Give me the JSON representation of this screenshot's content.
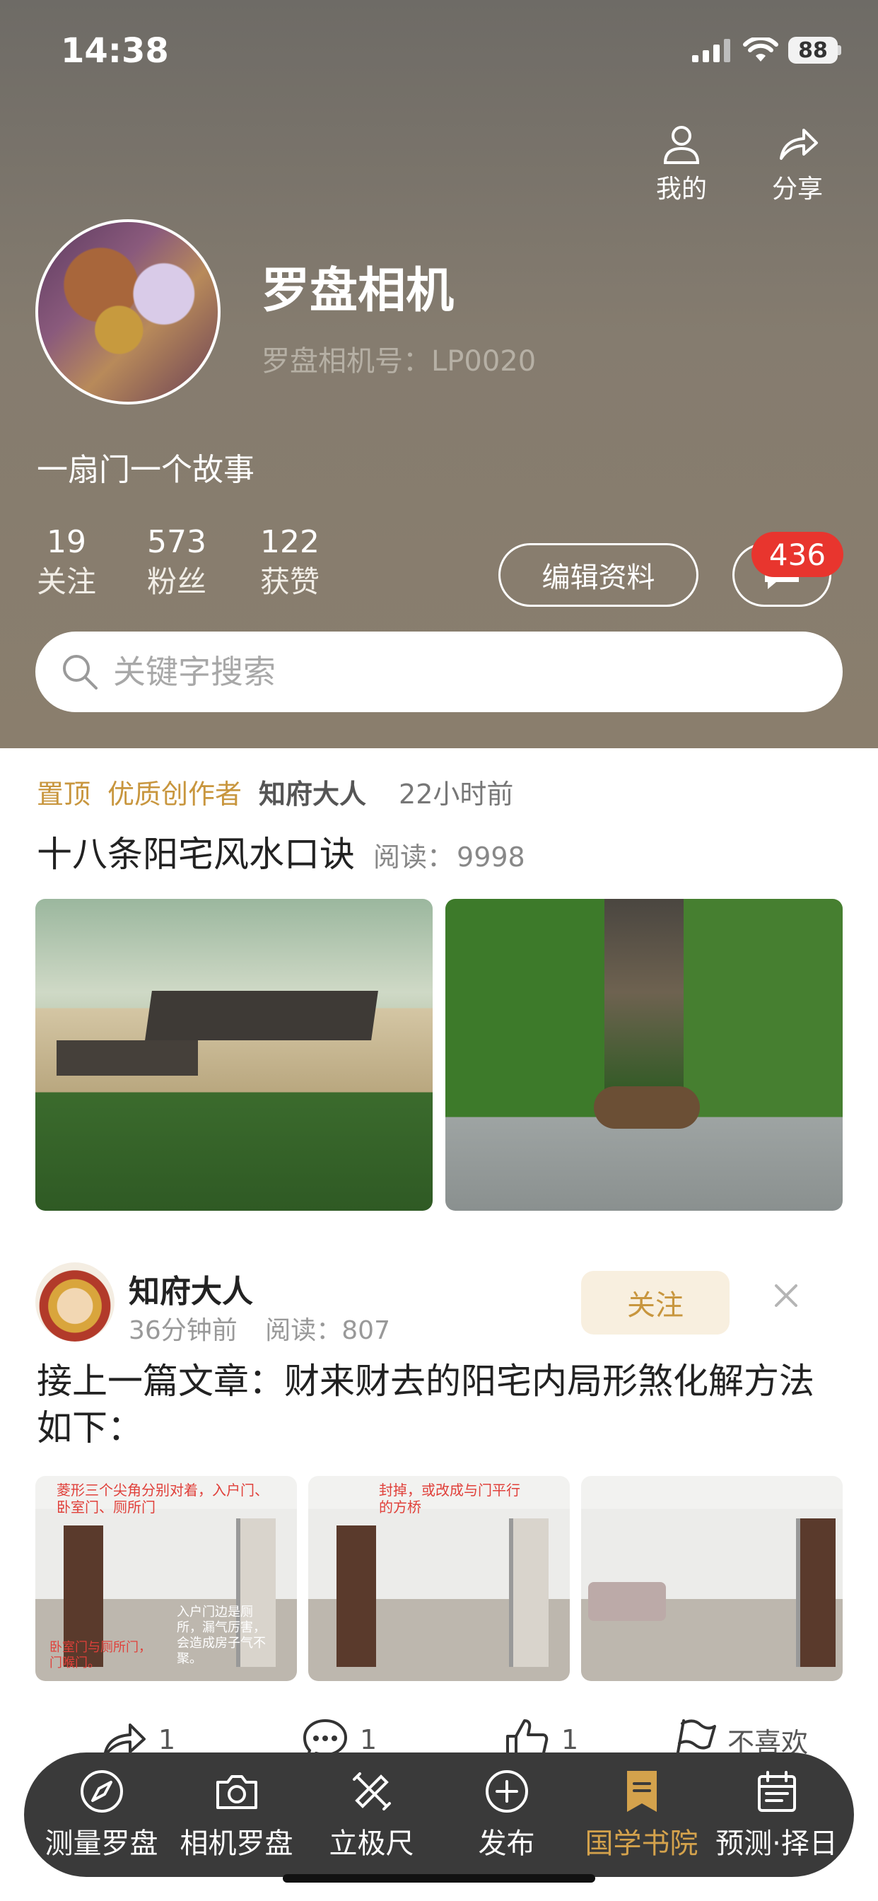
{
  "status_bar": {
    "time": "14:38",
    "battery": "88"
  },
  "top_actions": {
    "mine_label": "我的",
    "share_label": "分享"
  },
  "profile": {
    "name": "罗盘相机",
    "id_label": "罗盘相机号：",
    "id_value": "LP0020",
    "bio": "一扇门一个故事"
  },
  "stats": [
    {
      "num": "19",
      "label": "关注"
    },
    {
      "num": "573",
      "label": "粉丝"
    },
    {
      "num": "122",
      "label": "获赞"
    }
  ],
  "edit_profile_label": "编辑资料",
  "message_badge": "436",
  "search": {
    "placeholder": "关键字搜索",
    "value": ""
  },
  "post1": {
    "pin_tag": "置顶",
    "creator_tag": "优质创作者",
    "author": "知府大人",
    "time": "22小时前",
    "title": "十八条阳宅风水口诀",
    "read_label": "阅读：",
    "read_count": "9998"
  },
  "post2": {
    "author": "知府大人",
    "time": "36分钟前",
    "read_label": "阅读：",
    "read_count": "807",
    "follow_label": "关注",
    "title": "接上一篇文章：财来财去的阳宅内局形煞化解方法如下：",
    "image_notes": [
      "菱形三个尖角分别对着，入户门、卧室门、厕所门",
      "封掉，或改成与门平行的方桥",
      ""
    ],
    "image_notes_bottom": [
      "卧室门与厕所门，门喉门。",
      "",
      ""
    ],
    "image_notes_right": [
      "入户门边是厕所，漏气厉害，会造成房子气不聚。",
      "",
      ""
    ]
  },
  "actions": [
    {
      "icon": "share-icon",
      "count": "1"
    },
    {
      "icon": "comment-icon",
      "count": "1"
    },
    {
      "icon": "thumbs-up-icon",
      "count": "1"
    },
    {
      "icon": "flag-icon",
      "label": "不喜欢"
    }
  ],
  "tabbar": [
    {
      "icon": "compass-icon",
      "label": "测量罗盘",
      "active": false
    },
    {
      "icon": "camera-icon",
      "label": "相机罗盘",
      "active": false
    },
    {
      "icon": "ruler-icon",
      "label": "立极尺",
      "active": false
    },
    {
      "icon": "plus-circle-icon",
      "label": "发布",
      "active": false
    },
    {
      "icon": "bookmark-icon",
      "label": "国学书院",
      "active": true
    },
    {
      "icon": "calendar-icon",
      "label": "预测·择日",
      "active": false
    }
  ],
  "colors": {
    "accent": "#c8963e",
    "badge": "#e8352e",
    "tabbar_bg": "#3a3a3a"
  }
}
